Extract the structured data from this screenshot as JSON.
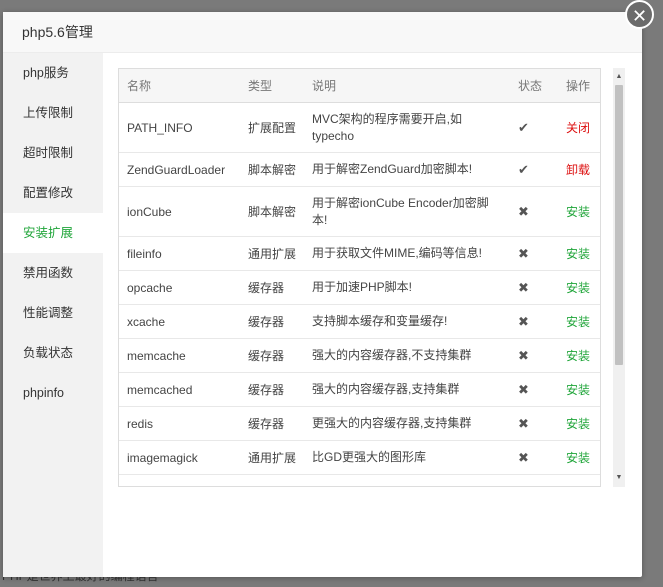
{
  "background_footer": "PHP是世界上最好的编程语言",
  "modal": {
    "title": "php5.6管理",
    "close_icon": "close-icon"
  },
  "colors": {
    "accent": "#20a53a",
    "danger": "#dd1111",
    "install": "#20a53a"
  },
  "sidebar": {
    "items": [
      {
        "label": "php服务"
      },
      {
        "label": "上传限制"
      },
      {
        "label": "超时限制"
      },
      {
        "label": "配置修改"
      },
      {
        "label": "安装扩展"
      },
      {
        "label": "禁用函数"
      },
      {
        "label": "性能调整"
      },
      {
        "label": "负载状态"
      },
      {
        "label": "phpinfo"
      }
    ],
    "active_index": 4
  },
  "table": {
    "headers": [
      "名称",
      "类型",
      "说明",
      "状态",
      "操作"
    ],
    "rows": [
      {
        "name": "PATH_INFO",
        "type": "扩展配置",
        "desc": "MVC架构的程序需要开启,如typecho",
        "status": "✔",
        "op": "关闭",
        "op_kind": "danger"
      },
      {
        "name": "ZendGuardLoader",
        "type": "脚本解密",
        "desc": "用于解密ZendGuard加密脚本!",
        "status": "✔",
        "op": "卸载",
        "op_kind": "danger"
      },
      {
        "name": "ionCube",
        "type": "脚本解密",
        "desc": "用于解密ionCube Encoder加密脚本!",
        "status": "✖",
        "op": "安装",
        "op_kind": "install"
      },
      {
        "name": "fileinfo",
        "type": "通用扩展",
        "desc": "用于获取文件MIME,编码等信息!",
        "status": "✖",
        "op": "安装",
        "op_kind": "install"
      },
      {
        "name": "opcache",
        "type": "缓存器",
        "desc": "用于加速PHP脚本!",
        "status": "✖",
        "op": "安装",
        "op_kind": "install"
      },
      {
        "name": "xcache",
        "type": "缓存器",
        "desc": "支持脚本缓存和变量缓存!",
        "status": "✖",
        "op": "安装",
        "op_kind": "install"
      },
      {
        "name": "memcache",
        "type": "缓存器",
        "desc": "强大的内容缓存器,不支持集群",
        "status": "✖",
        "op": "安装",
        "op_kind": "install"
      },
      {
        "name": "memcached",
        "type": "缓存器",
        "desc": "强大的内容缓存器,支持集群",
        "status": "✖",
        "op": "安装",
        "op_kind": "install"
      },
      {
        "name": "redis",
        "type": "缓存器",
        "desc": "更强大的内容缓存器,支持集群",
        "status": "✖",
        "op": "安装",
        "op_kind": "install"
      },
      {
        "name": "imagemagick",
        "type": "通用扩展",
        "desc": "比GD更强大的图形库",
        "status": "✖",
        "op": "安装",
        "op_kind": "install"
      }
    ]
  },
  "scrollbar": {
    "up_icon": "scroll-up-arrow-icon",
    "down_icon": "scroll-down-arrow-icon"
  }
}
